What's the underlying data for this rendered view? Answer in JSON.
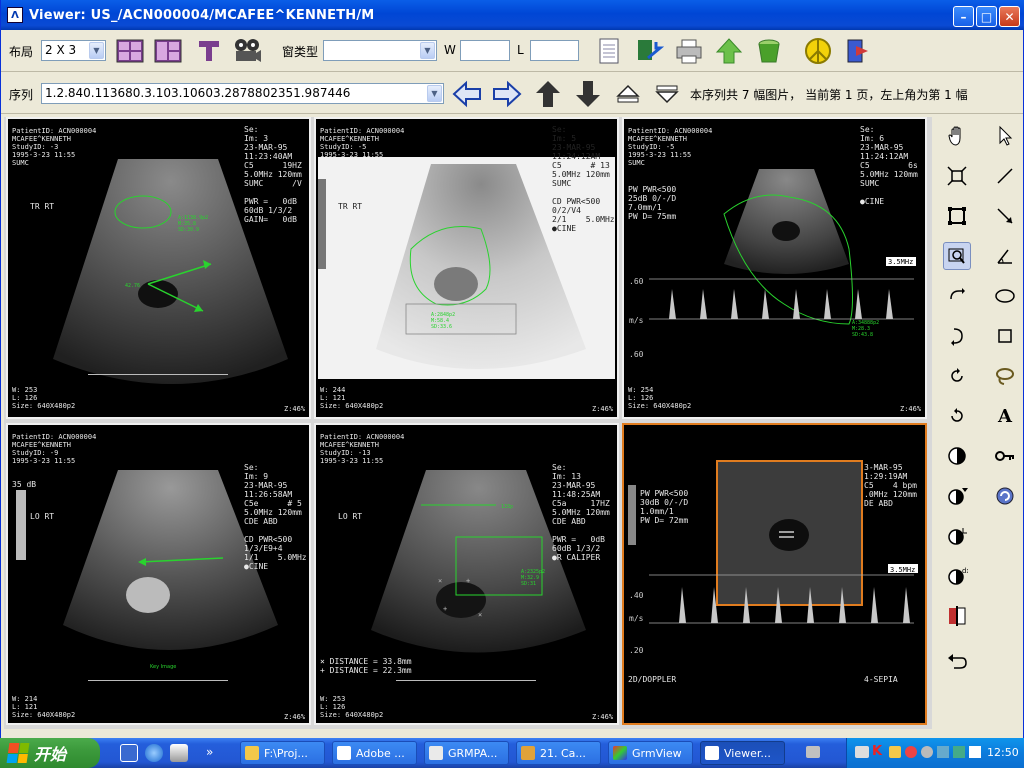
{
  "window": {
    "title": "Viewer:   US_/ACN000004/MCAFEE^KENNETH/M"
  },
  "toolbar1": {
    "layout_label": "布局",
    "layout_value": "2 X 3",
    "window_type_label": "窗类型",
    "window_type_value": "",
    "w_label": "W",
    "w_value": "",
    "l_label": "L",
    "l_value": ""
  },
  "toolbar2": {
    "series_label": "序列",
    "series_value": "1.2.840.113680.3.103.10603.2878802351.987446",
    "status_text": "本序列共 7 幅图片， 当前第 1 页，左上角为第 1 幅"
  },
  "panels": [
    {
      "patient": "PatientID: ACN000004\nMCAFEE^KENNETH\nStudyID: -3\n1995-3-23 11:55\nSUMC",
      "right": "Se:\nIm: 3\n23-MAR-95\n11:23:40AM\nC5      19HZ\n5.0MHz 120mm\nSUMC      /V\n\nPWR =   0dB\n60dB 1/3/2\nGAIN=   0dB",
      "orient": "TR RT",
      "wl": "W: 253\nL: 126\nSize: 640X480p2",
      "zoom": "Z:46%"
    },
    {
      "patient": "PatientID: ACN000004\nMCAFEE^KENNETH\nStudyID: -5\n1995-3-23 11:55",
      "right": "Se:\nIm: 5\n23-MAR-95\n11:24:12AM\nC5      # 13\n5.0MHz 120mm\nSUMC\n\nCD PWR<500\n0/2/V4\n2/1    5.0MHz\n●CINE",
      "orient": "TR RT",
      "wl": "W: 244\nL: 121\nSize: 640X480p2",
      "zoom": "Z:46%"
    },
    {
      "patient": "PatientID: ACN000004\nMCAFEE^KENNETH\nStudyID: -5\n1995-3-23 11:55\nSUMC",
      "right": "Se:\nIm: 6\n23-MAR-95\n11:24:12AM\nC5        6s\n5.0MHz 120mm\nSUMC\n\n●CINE",
      "doppler": "PW PWR<500\n25dB 0/-/D\n7.0mm/1\nPW D= 75mm",
      "wl": "W: 254\nL: 126\nSize: 640X480p2",
      "zoom": "Z:46%"
    },
    {
      "patient": "PatientID: ACN000004\nMCAFEE^KENNETH\nStudyID: -9\n1995-3-23 11:55",
      "right": "Se:\nIm: 9\n23-MAR-95\n11:26:58AM\nC5e      # 5\n5.0MHz 120mm\nCDE ABD\n\nCD PWR<500\n1/3/E9+4\n1/1    5.0MHz\n●CINE",
      "orient": "LO RT",
      "db": "35 dB",
      "note": "Key Image",
      "wl": "W: 214\nL: 121\nSize: 640X480p2",
      "zoom": "Z:46%"
    },
    {
      "patient": "PatientID: ACN000004\nMCAFEE^KENNETH\nStudyID: -13\n1995-3-23 11:55",
      "right": "Se:\nIm: 13\n23-MAR-95\n11:48:25AM\nC5a     17HZ\n5.0MHz 120mm\nCDE ABD\n\nPWR =   0dB\n60dB 1/3/2\n●R CALIPER",
      "orient": "LO RT",
      "measure": "× DISTANCE = 33.8mm\n+ DISTANCE = 22.3mm",
      "wl": "W: 253\nL: 126\nSize: 640X480p2",
      "zoom": "Z:46%"
    },
    {
      "doppler": "PW PWR<500\n30dB 0/-/D\n1.0mm/1\nPW D= 72mm",
      "right": "3-MAR-95\n1:29:19AM\nC5    4 bpm\n.0MHz 120mm\nDE ABD",
      "bottom_left": "2D/DOPPLER",
      "bottom_right": "4-SEPIA",
      "freq": "3.5MHz"
    }
  ],
  "taskbar": {
    "start_label": "开始",
    "tasks": [
      "F:\\Proj...",
      "Adobe ...",
      "GRMPA...",
      "21. Ca...",
      "GrmView",
      "Viewer..."
    ],
    "clock": "12:50"
  }
}
